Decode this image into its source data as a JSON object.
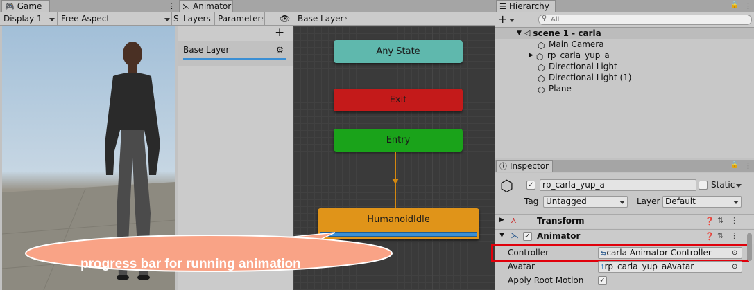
{
  "game": {
    "tab_title": "Game",
    "display_label": "Display 1",
    "aspect_label": "Free Aspect",
    "cut_label": "S"
  },
  "animator": {
    "tab_title": "Animator",
    "tabs": [
      "Layers",
      "Parameters"
    ],
    "breadcrumb": "Base Layer",
    "layer_item": "Base Layer",
    "add_symbol": "+",
    "nodes": {
      "any_state": "Any State",
      "exit": "Exit",
      "entry": "Entry",
      "idle": "HumanoidIdle"
    },
    "idle_progress": 1.0,
    "callout_text": "progress bar for running animation"
  },
  "hierarchy": {
    "tab_title": "Hierarchy",
    "add_symbol": "+",
    "search_placeholder": "All",
    "scene_name": "scene 1 - carla",
    "items": [
      "Main Camera",
      "rp_carla_yup_a",
      "Directional Light",
      "Directional Light (1)",
      "Plane"
    ]
  },
  "inspector": {
    "tab_title": "Inspector",
    "object_name": "rp_carla_yup_a",
    "active_checked": true,
    "static_label": "Static",
    "tag_label": "Tag",
    "tag_value": "Untagged",
    "layer_label": "Layer",
    "layer_value": "Default",
    "components": {
      "transform": "Transform",
      "animator": "Animator"
    },
    "fields": {
      "controller_label": "Controller",
      "controller_value": "carla Animator Controller",
      "avatar_label": "Avatar",
      "avatar_value": "rp_carla_yup_aAvatar",
      "apply_root_motion_label": "Apply Root Motion",
      "apply_root_motion_checked": true
    },
    "highlight_color": "#e0000b"
  },
  "colors": {
    "any_state": "#5fb8ad",
    "exit": "#c41a1a",
    "entry": "#1aa31a",
    "idle": "#e09419",
    "progress": "#3b8fd4",
    "callout": "#f9a386"
  }
}
